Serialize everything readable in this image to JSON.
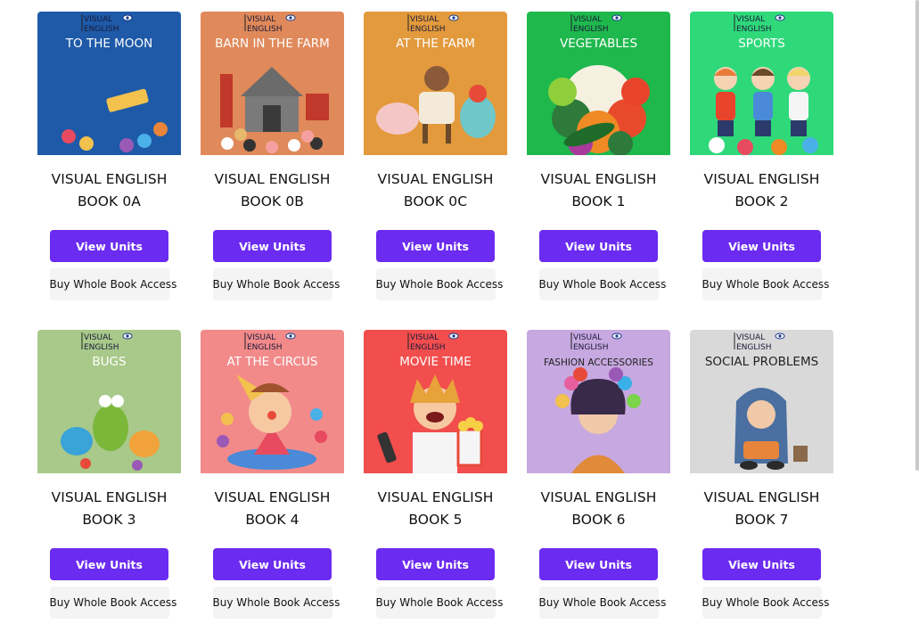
{
  "buttons": {
    "view_units": "View Units",
    "buy_access": "Buy Whole Book Access"
  },
  "books": [
    {
      "series": "VISUAL ENGLISH",
      "book": "BOOK 0A",
      "cover_title": "TO THE MOON",
      "bg": "#1e5aa8",
      "fg": "#ffffff",
      "icon": "moon-icon",
      "accent": "#f3e6c8"
    },
    {
      "series": "VISUAL ENGLISH",
      "book": "BOOK 0B",
      "cover_title": "BARN IN THE FARM",
      "bg": "#e0895a",
      "fg": "#ffffff",
      "icon": "barn-icon",
      "accent": "#c0392b"
    },
    {
      "series": "VISUAL ENGLISH",
      "book": "BOOK 0C",
      "cover_title": "AT THE FARM",
      "bg": "#e39a3c",
      "fg": "#ffffff",
      "icon": "cow-icon",
      "accent": "#f5c6c6"
    },
    {
      "series": "VISUAL ENGLISH",
      "book": "BOOK 1",
      "cover_title": "VEGETABLES",
      "bg": "#1fb84d",
      "fg": "#ffffff",
      "icon": "vegetables-icon",
      "accent": "#e8442b"
    },
    {
      "series": "VISUAL ENGLISH",
      "book": "BOOK 2",
      "cover_title": "SPORTS",
      "bg": "#2fd97a",
      "fg": "#ffffff",
      "icon": "sports-icon",
      "accent": "#f08a24"
    },
    {
      "series": "VISUAL ENGLISH",
      "book": "BOOK 3",
      "cover_title": "BUGS",
      "bg": "#a8c98a",
      "fg": "#ffffff",
      "icon": "bug-icon",
      "accent": "#3aa3d8"
    },
    {
      "series": "VISUAL ENGLISH",
      "book": "BOOK 4",
      "cover_title": "AT THE CIRCUS",
      "bg": "#f28a8a",
      "fg": "#ffffff",
      "icon": "circus-icon",
      "accent": "#e84a5f"
    },
    {
      "series": "VISUAL ENGLISH",
      "book": "BOOK 5",
      "cover_title": "MOVIE TIME",
      "bg": "#f24e4e",
      "fg": "#ffffff",
      "icon": "popcorn-icon",
      "accent": "#f7d046"
    },
    {
      "series": "VISUAL ENGLISH",
      "book": "BOOK 6",
      "cover_title": "FASHION ACCESSORIES",
      "bg": "#c7a8e0",
      "fg": "#222222",
      "icon": "fashion-icon",
      "accent": "#e85fa0"
    },
    {
      "series": "VISUAL ENGLISH",
      "book": "BOOK 7",
      "cover_title": "SOCIAL PROBLEMS",
      "bg": "#d9d9d9",
      "fg": "#222222",
      "icon": "hoodie-icon",
      "accent": "#4a6fa0"
    }
  ]
}
